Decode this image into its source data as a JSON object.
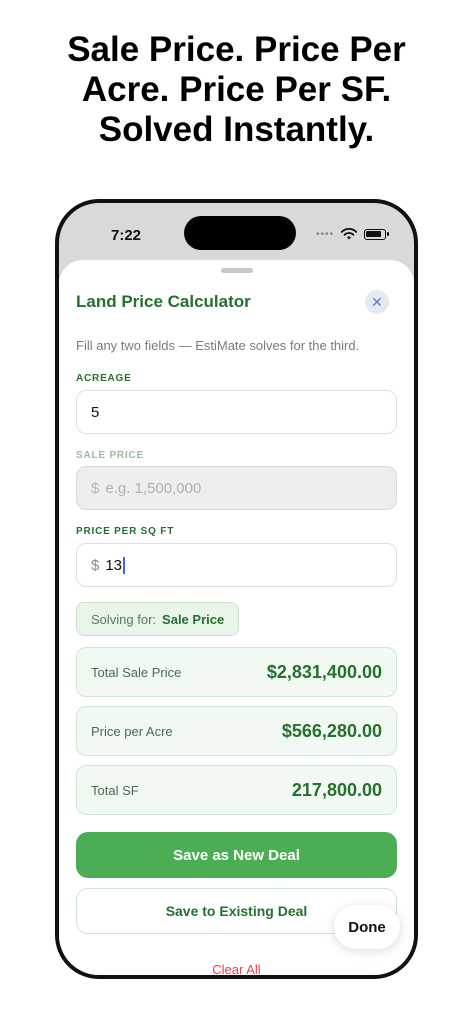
{
  "headline": {
    "line1": "Sale Price. Price Per",
    "line2": "Acre. Price Per SF.",
    "line3": "Solved Instantly."
  },
  "status_bar": {
    "time": "7:22"
  },
  "sheet": {
    "title": "Land Price Calculator",
    "hint": "Fill any two fields — EstiMate solves for the third."
  },
  "fields": {
    "acreage": {
      "label": "ACREAGE",
      "value": "5"
    },
    "sale_price": {
      "label": "SALE PRICE",
      "prefix": "$",
      "placeholder": "e.g. 1,500,000"
    },
    "price_per_sqft": {
      "label": "PRICE PER SQ FT",
      "prefix": "$",
      "value": "13"
    }
  },
  "solving": {
    "label": "Solving for:",
    "target": "Sale Price"
  },
  "results": [
    {
      "label": "Total Sale Price",
      "value": "$2,831,400.00"
    },
    {
      "label": "Price per Acre",
      "value": "$566,280.00"
    },
    {
      "label": "Total SF",
      "value": "217,800.00"
    }
  ],
  "actions": {
    "save_new": "Save as New Deal",
    "save_existing": "Save to Existing Deal",
    "clear_all": "Clear All",
    "done": "Done"
  },
  "icons": {
    "close": "close-icon",
    "wifi": "wifi-icon",
    "battery": "battery-icon",
    "signal": "signal-dots-icon"
  },
  "colors": {
    "accent_green": "#25702f",
    "button_green": "#4cae54",
    "destructive_red": "#e5424d"
  }
}
